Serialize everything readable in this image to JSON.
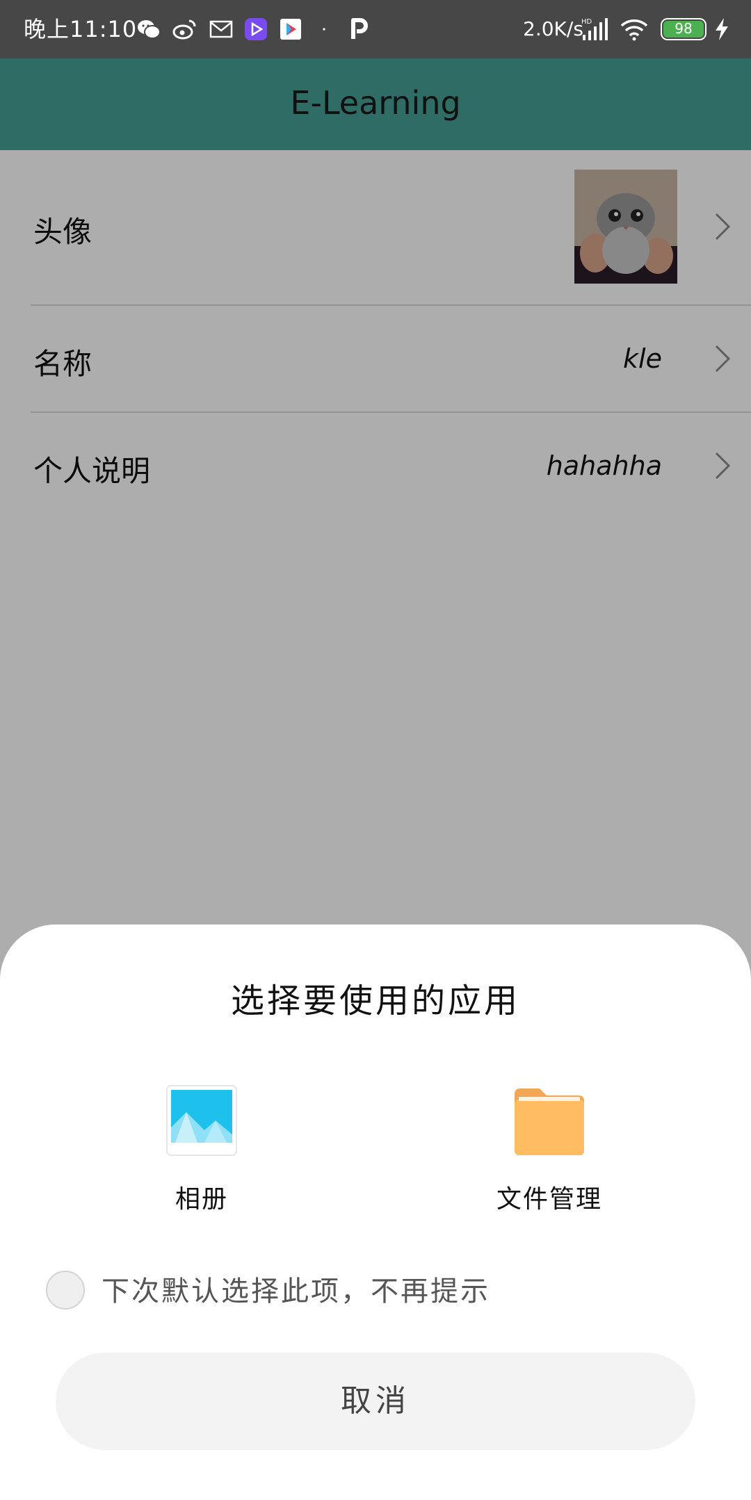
{
  "status_bar": {
    "time": "晚上11:10",
    "network_speed": "2.0K/s",
    "signal_label": "HD",
    "battery_level": "98",
    "icons": [
      "wechat-icon",
      "weibo-icon",
      "mail-icon",
      "video-app-icon",
      "play-store-icon",
      "dot-icon",
      "p-app-icon",
      "signal-icon",
      "wifi-icon",
      "battery-icon",
      "charging-icon"
    ]
  },
  "app_bar": {
    "title": "E-Learning"
  },
  "profile": {
    "rows": [
      {
        "label": "头像",
        "value": ""
      },
      {
        "label": "名称",
        "value": "kle"
      },
      {
        "label": "个人说明",
        "value": "hahahha"
      }
    ]
  },
  "sheet": {
    "title": "选择要使用的应用",
    "apps": [
      {
        "label": "相册",
        "icon": "gallery-icon"
      },
      {
        "label": "文件管理",
        "icon": "folder-icon"
      }
    ],
    "remember_label": "下次默认选择此项，不再提示",
    "remember_checked": false,
    "cancel_label": "取消"
  },
  "colors": {
    "app_bar": "#2f6c65",
    "status_bar": "#474747",
    "battery": "#4caf50",
    "gallery_sky": "#1ec0ec",
    "folder": "#ffbc63"
  }
}
